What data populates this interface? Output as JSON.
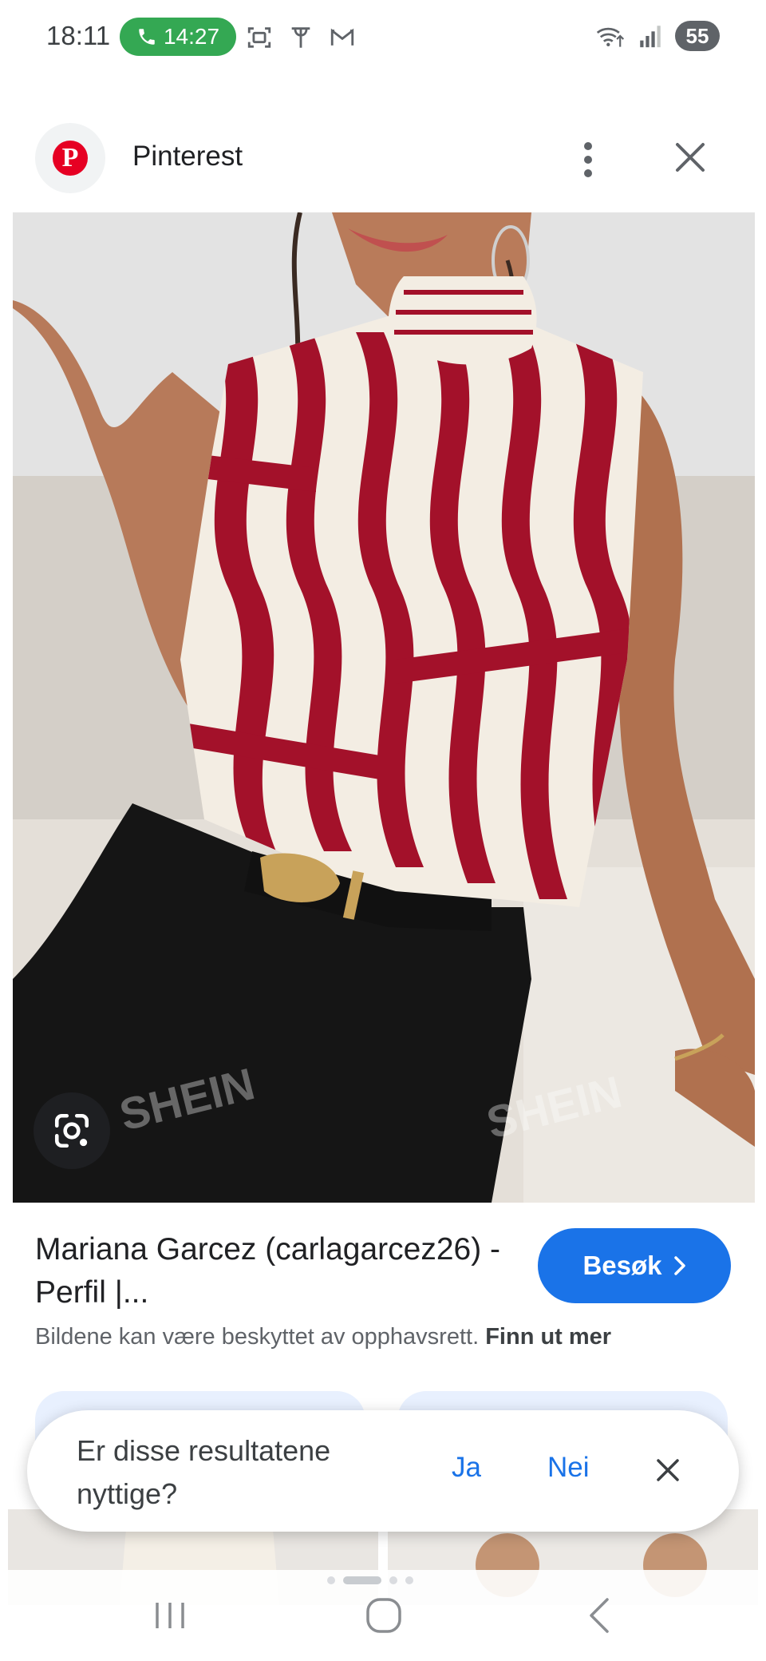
{
  "status_bar": {
    "time": "18:11",
    "call_timer": "14:27",
    "battery": "55",
    "icons": [
      "phone-icon",
      "screenshot-icon",
      "antenna-icon",
      "gmail-icon",
      "wifi-icon",
      "signal-icon"
    ]
  },
  "header": {
    "site_name": "Pinterest",
    "logo_letter": "P",
    "icons": [
      "more-vert-icon",
      "close-icon"
    ]
  },
  "main_image": {
    "watermark": "SHEIN",
    "icons": [
      "lens-icon"
    ]
  },
  "result": {
    "title": "Mariana Garcez (carlagarcez26) - Perfil |...",
    "visit_label": "Besøk",
    "copyright_text": "Bildene kan være beskyttet av opphavsrett.",
    "learn_more": "Finn ut mer"
  },
  "feedback": {
    "question": "Er disse resultatene nyttige?",
    "yes": "Ja",
    "no": "Nei"
  },
  "nav_bar": {
    "icons": [
      "recents-icon",
      "home-icon",
      "back-icon"
    ]
  },
  "colors": {
    "accent": "#1a73e8",
    "call_green": "#34a853",
    "pinterest_red": "#e60023",
    "blouse_red": "#a3112a"
  }
}
